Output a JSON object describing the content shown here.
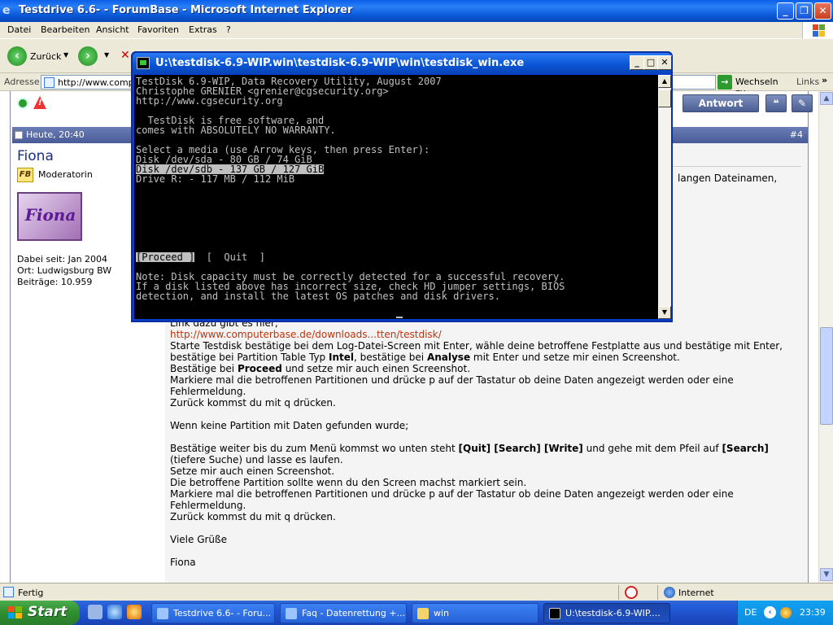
{
  "ie": {
    "title": "Testdrive 6.6- - ForumBase - Microsoft Internet Explorer",
    "caption_buttons": {
      "minimize": "_",
      "maximize": "❐",
      "close": "✕"
    },
    "menu": [
      "Datei",
      "Bearbeiten",
      "Ansicht",
      "Favoriten",
      "Extras",
      "?"
    ],
    "toolbar": {
      "back_label": "Zurück"
    },
    "address": {
      "label": "Adresse",
      "value": "http://www.compu",
      "go_label": "Wechseln zu",
      "links_label": "Links",
      "links_chevron": "»"
    }
  },
  "forum": {
    "reply_button": "Antwort",
    "post": {
      "date": "Heute, 20:40",
      "number": "#4",
      "username": "Fiona",
      "role_badge": "FB",
      "role": "Moderatorin",
      "avatar_text": "Fiona",
      "meta": [
        "Dabei seit: Jan 2004",
        "Ort: Ludwigsburg BW",
        "Beiträge: 10.959"
      ],
      "snippet": "langen Dateinamen,",
      "link_intro": "Link dazu gibt es hier;",
      "link": "http://www.computerbase.de/downloads...tten/testdisk/",
      "p1": [
        {
          "t": "Starte Testdisk bestätige bei dem Log-Datei-Screen mit Enter, wähle deine betroffene Festplatte aus und bestätige mit Enter, bestätige bei Partition Table Typ "
        },
        {
          "t": "Intel",
          "b": true
        },
        {
          "t": ", bestätige bei "
        },
        {
          "t": "Analyse",
          "b": true
        },
        {
          "t": " mit Enter und setze mir einen Screenshot."
        }
      ],
      "p2": [
        {
          "t": "Bestätige bei "
        },
        {
          "t": "Proceed",
          "b": true
        },
        {
          "t": " und setze mir auch einen Screenshot."
        }
      ],
      "line_mark1": "Markiere mal die betroffenen Partitionen und drücke p auf der Tastatur ob deine Daten angezeigt werden oder eine Fehlermeldung.",
      "line_back1": "Zurück kommst du mit q drücken.",
      "line_none": "Wenn keine Partition mit Daten gefunden wurde;",
      "p3": [
        {
          "t": "Bestätige weiter bis du zum Menü kommst wo unten steht "
        },
        {
          "t": "[Quit] [Search] [Write]",
          "b": true
        },
        {
          "t": " und gehe mit dem Pfeil auf "
        },
        {
          "t": "[Search]",
          "b": true
        },
        {
          "t": " (tiefere Suche) und lasse es laufen."
        }
      ],
      "line_shot": "Setze mir auch einen Screenshot.",
      "line_marked": "Die betroffene Partition sollte wenn du den Screen machst markiert sein.",
      "line_mark2": "Markiere mal die betroffenen Partitionen und drücke p auf der Tastatur ob deine Daten angezeigt werden oder eine Fehlermeldung.",
      "line_back2": "Zurück kommst du mit q drücken.",
      "greeting": "Viele Grüße",
      "signature": "Fiona"
    }
  },
  "status_bar": {
    "text": "Fertig",
    "zone": "Internet"
  },
  "console": {
    "title": "U:\\testdisk-6.9-WIP.win\\testdisk-6.9-WIP\\win\\testdisk_win.exe",
    "lines": [
      "TestDisk 6.9-WIP, Data Recovery Utility, August 2007",
      "Christophe GRENIER <grenier@cgsecurity.org>",
      "http://www.cgsecurity.org",
      "",
      "  TestDisk is free software, and",
      "comes with ABSOLUTELY NO WARRANTY.",
      "",
      "Select a media (use Arrow keys, then press Enter):",
      "Disk /dev/sda - 80 GB / 74 GiB",
      "Disk /dev/sdb - 137 GB / 127 GiB",
      "Drive R: - 117 MB / 112 MiB",
      "",
      "",
      "",
      "",
      "",
      "",
      "",
      "",
      "",
      "Note: Disk capacity must be correctly detected for a successful recovery.",
      "If a disk listed above has incorrect size, check HD jumper settings, BIOS",
      "detection, and install the latest OS patches and disk drivers."
    ],
    "selected_line_index": 9,
    "proceed": "[Proceed ]",
    "quit": "[  Quit  ]"
  },
  "taskbar": {
    "start": "Start",
    "tasks": [
      {
        "label": "Testdrive 6.6- - Foru...",
        "active": false
      },
      {
        "label": "Faq - Datenrettung +...",
        "active": false
      },
      {
        "label": "win",
        "active": false
      },
      {
        "label": "U:\\testdisk-6.9-WIP....",
        "active": true
      }
    ],
    "tray": {
      "lang": "DE",
      "clock": "23:39",
      "chevron": "‹"
    }
  }
}
